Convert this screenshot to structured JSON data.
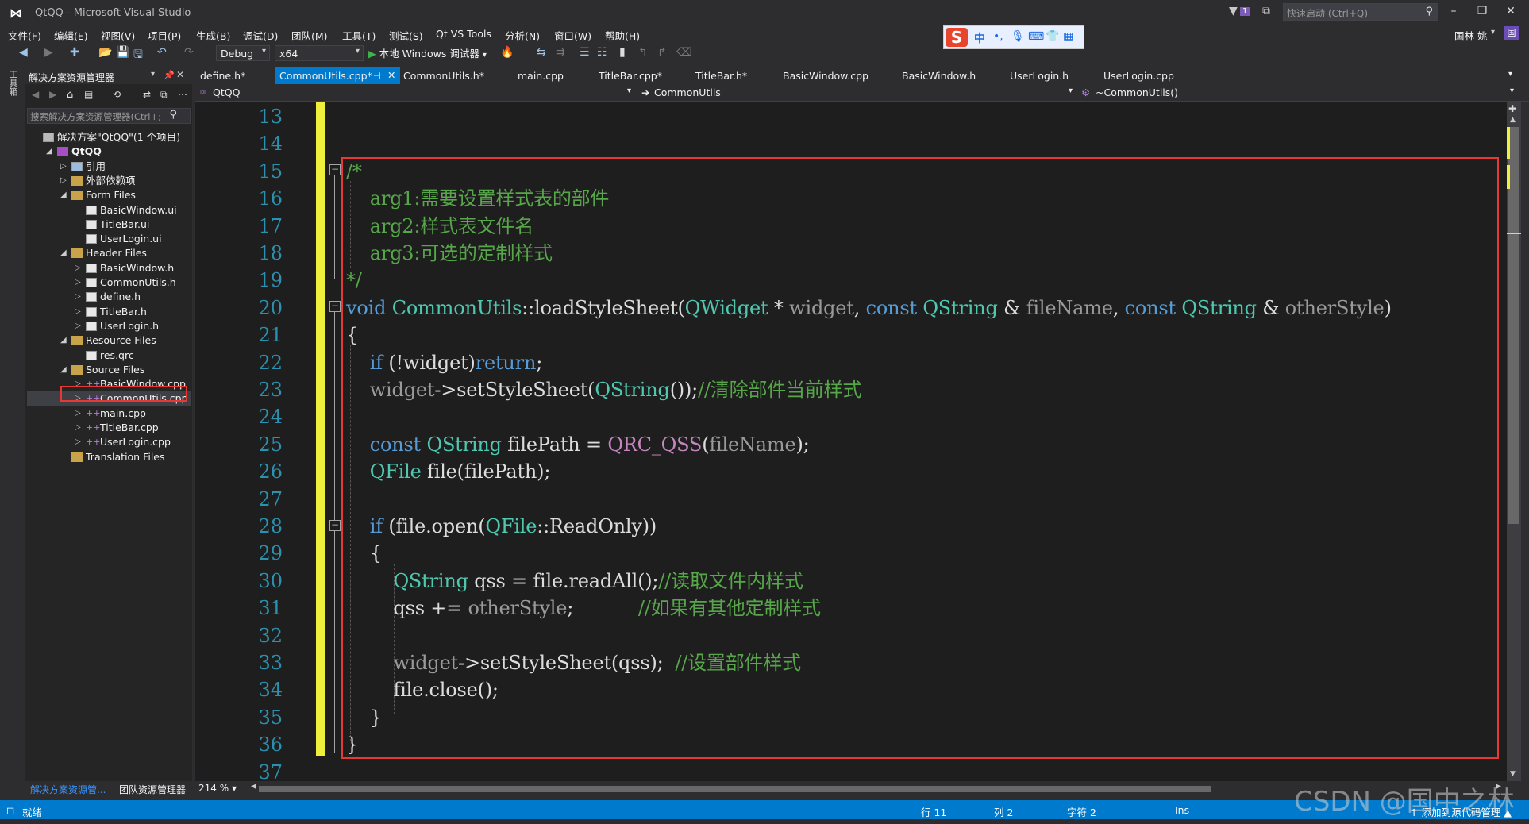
{
  "window": {
    "title": "QtQQ - Microsoft Visual Studio",
    "quick_launch_placeholder": "快速启动 (Ctrl+Q)",
    "notification_count": "1"
  },
  "menu": [
    "文件(F)",
    "编辑(E)",
    "视图(V)",
    "项目(P)",
    "生成(B)",
    "调试(D)",
    "团队(M)",
    "工具(T)",
    "测试(S)",
    "Qt VS Tools",
    "分析(N)",
    "窗口(W)",
    "帮助(H)"
  ],
  "ime": {
    "logo": "S",
    "lang": "中"
  },
  "user": {
    "name": "国林 姚",
    "initial": "国"
  },
  "toolbar": {
    "config": "Debug",
    "platform": "x64",
    "run_label": "本地 Windows 调试器"
  },
  "toolbox_label": "工具箱",
  "solution_explorer": {
    "title": "解决方案资源管理器",
    "search_placeholder": "搜索解决方案资源管理器(Ctrl+;",
    "items": [
      {
        "label": "解决方案\"QtQQ\"(1 个项目)",
        "kind": "solution",
        "expanded": ""
      },
      {
        "label": "QtQQ",
        "kind": "project",
        "expanded": "◢"
      },
      {
        "label": "引用",
        "kind": "ref",
        "expanded": "▷"
      },
      {
        "label": "外部依赖项",
        "kind": "folder",
        "expanded": "▷"
      },
      {
        "label": "Form Files",
        "kind": "folder",
        "expanded": "◢"
      },
      {
        "label": "BasicWindow.ui",
        "kind": "file",
        "expanded": ""
      },
      {
        "label": "TitleBar.ui",
        "kind": "file",
        "expanded": ""
      },
      {
        "label": "UserLogin.ui",
        "kind": "file",
        "expanded": ""
      },
      {
        "label": "Header Files",
        "kind": "folder",
        "expanded": "◢"
      },
      {
        "label": "BasicWindow.h",
        "kind": "file",
        "expanded": "▷"
      },
      {
        "label": "CommonUtils.h",
        "kind": "file",
        "expanded": "▷"
      },
      {
        "label": "define.h",
        "kind": "file",
        "expanded": "▷"
      },
      {
        "label": "TitleBar.h",
        "kind": "file",
        "expanded": "▷"
      },
      {
        "label": "UserLogin.h",
        "kind": "file",
        "expanded": "▷"
      },
      {
        "label": "Resource Files",
        "kind": "folder",
        "expanded": "◢"
      },
      {
        "label": "res.qrc",
        "kind": "file",
        "expanded": ""
      },
      {
        "label": "Source Files",
        "kind": "folder",
        "expanded": "◢"
      },
      {
        "label": "BasicWindow.cpp",
        "kind": "cpp",
        "expanded": "▷"
      },
      {
        "label": "CommonUtils.cpp",
        "kind": "cpp",
        "expanded": "▷"
      },
      {
        "label": "main.cpp",
        "kind": "cpp",
        "expanded": "▷"
      },
      {
        "label": "TitleBar.cpp",
        "kind": "cpp",
        "expanded": "▷"
      },
      {
        "label": "UserLogin.cpp",
        "kind": "cpp",
        "expanded": "▷"
      },
      {
        "label": "Translation Files",
        "kind": "folder",
        "expanded": ""
      }
    ],
    "bottom_tabs": [
      "解决方案资源管...",
      "团队资源管理器"
    ]
  },
  "editor_tabs": [
    "define.h*",
    "CommonUtils.cpp*",
    "CommonUtils.h*",
    "main.cpp",
    "TitleBar.cpp*",
    "TitleBar.h*",
    "BasicWindow.cpp",
    "BasicWindow.h",
    "UserLogin.h",
    "UserLogin.cpp"
  ],
  "navbar": {
    "project": "QtQQ",
    "scope": "CommonUtils",
    "member": "~CommonUtils()"
  },
  "editor": {
    "line_numbers": [
      "13",
      "14",
      "15",
      "16",
      "17",
      "18",
      "19",
      "20",
      "21",
      "22",
      "23",
      "24",
      "25",
      "26",
      "27",
      "28",
      "29",
      "30",
      "31",
      "32",
      "33",
      "34",
      "35",
      "36",
      "37"
    ],
    "lines": [
      "",
      "",
      "/*",
      "    arg1:需要设置样式表的部件",
      "    arg2:样式表文件名",
      "    arg3:可选的定制样式",
      "*/",
      "void CommonUtils::loadStyleSheet(QWidget * widget, const QString & fileName, const QString & otherStyle)",
      "{",
      "    if (!widget)return;",
      "    widget->setStyleSheet(QString());//清除部件当前样式",
      "",
      "    const QString filePath = QRC_QSS(fileName);",
      "    QFile file(filePath);",
      "",
      "    if (file.open(QFile::ReadOnly))",
      "    {",
      "        QString qss = file.readAll();//读取文件内样式",
      "        qss += otherStyle;           //如果有其他定制样式",
      "",
      "        widget->setStyleSheet(qss);  //设置部件样式",
      "        file.close();",
      "    }",
      "}",
      ""
    ],
    "zoom": "214 %"
  },
  "status": {
    "ready": "就绪",
    "line": "行 11",
    "col": "列 2",
    "char": "字符 2",
    "mode": "Ins",
    "source_control": "↑ 添加到源代码管理 ▲"
  },
  "watermark": "CSDN @国中之林",
  "colors": {
    "accent": "#007acc",
    "highlight": "#e53935",
    "change_bar": "#efef3c",
    "comment": "#57a64a",
    "keyword": "#569cd6",
    "type": "#4ec9b0"
  }
}
